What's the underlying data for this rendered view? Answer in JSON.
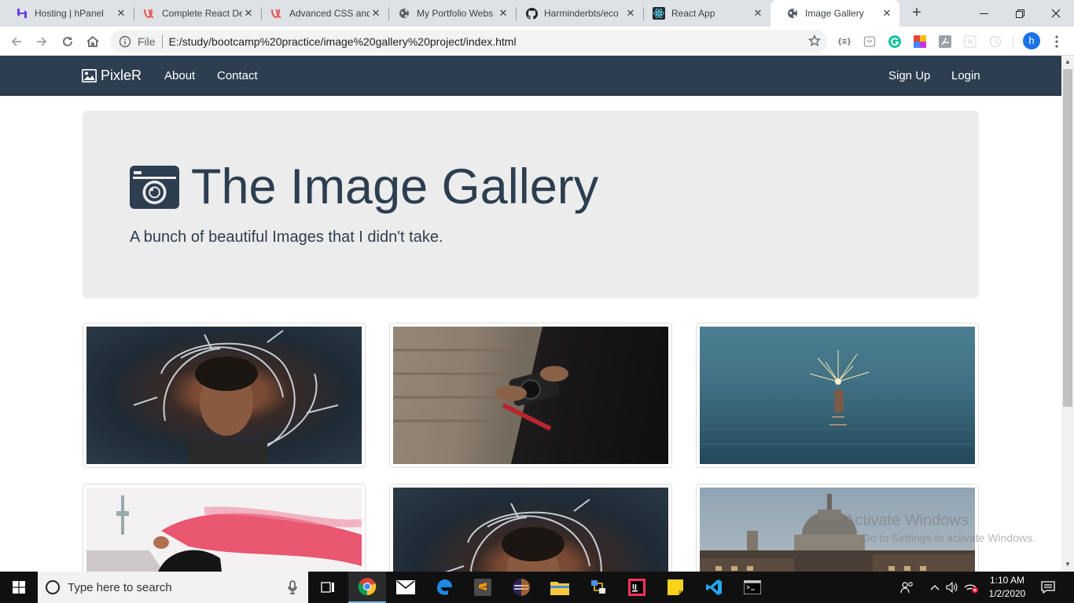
{
  "browser": {
    "tabs": [
      {
        "title": "Hosting | hPanel",
        "icon": "hostinger-icon"
      },
      {
        "title": "Complete React De",
        "icon": "udemy-icon"
      },
      {
        "title": "Advanced CSS and",
        "icon": "udemy-icon"
      },
      {
        "title": "My Portfolio Webs",
        "icon": "globe-icon"
      },
      {
        "title": "Harminderbts/eco",
        "icon": "github-icon"
      },
      {
        "title": "React App",
        "icon": "react-icon"
      },
      {
        "title": "Image Gallery",
        "icon": "globe-icon",
        "active": true
      }
    ],
    "new_tab": "+",
    "address": {
      "scheme_label": "File",
      "url": "E:/study/bootcamp%20practice/image%20gallery%20project/index.html"
    },
    "extension_label": "{≡}",
    "profile_initial": "h"
  },
  "site": {
    "nav": {
      "brand": "PixleR",
      "links": [
        "About",
        "Contact"
      ],
      "right_links": [
        "Sign Up",
        "Login"
      ]
    },
    "hero": {
      "title": "The Image Gallery",
      "subtitle": "A bunch of beautiful Images that I didn't take."
    },
    "gallery": [
      {
        "alt": "girl-with-sparkler"
      },
      {
        "alt": "hands-holding-camera"
      },
      {
        "alt": "sparkler-in-water"
      },
      {
        "alt": "red-smoke-flare"
      },
      {
        "alt": "girl-with-sparkler"
      },
      {
        "alt": "city-cathedral"
      }
    ]
  },
  "watermark": {
    "line1": "Activate Windows",
    "line2": "Go to Settings to activate Windows."
  },
  "taskbar": {
    "search_placeholder": "Type here to search",
    "time": "1:10 AM",
    "date": "1/2/2020"
  },
  "colors": {
    "navbar": "#2c3e50",
    "hero_bg": "#ececec",
    "hero_text": "#2c3e50",
    "taskbar": "#101010"
  }
}
